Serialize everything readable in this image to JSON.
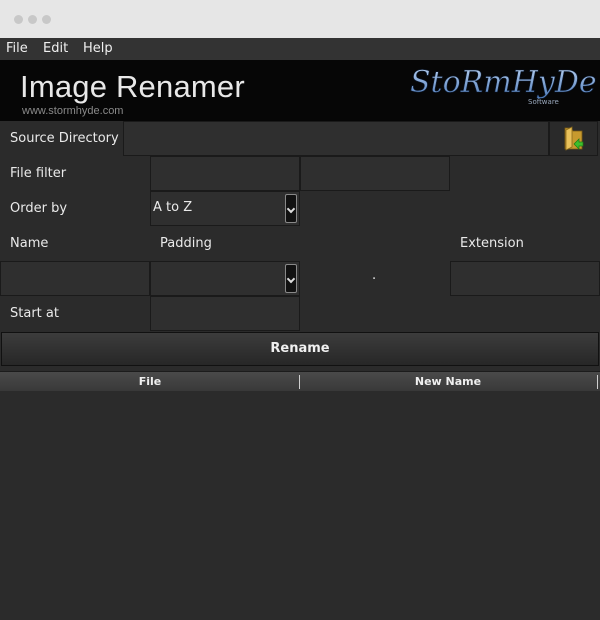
{
  "menu": {
    "items": [
      "File",
      "Edit",
      "Help"
    ]
  },
  "banner": {
    "title": "Image Renamer",
    "url": "www.stormhyde.com",
    "logo_text": "StoRmHyDe",
    "logo_sub": "Software"
  },
  "form": {
    "source_directory_label": "Source Directory",
    "source_directory_value": "",
    "file_filter_label": "File filter",
    "file_filter_value_1": "",
    "file_filter_value_2": "",
    "order_by_label": "Order by",
    "order_by_value": "A to Z",
    "name_label": "Name",
    "padding_label": "Padding",
    "extension_label": "Extension",
    "name_value": "",
    "padding_value": "",
    "separator": ".",
    "extension_value": "",
    "start_at_label": "Start at",
    "start_at_value": ""
  },
  "rename_button": "Rename",
  "table": {
    "columns": [
      "File",
      "New Name"
    ],
    "rows": []
  },
  "icons": {
    "folder": "folder-arrow-icon",
    "dropdown": "chevron-down-icon"
  },
  "colors": {
    "background": "#2b2b2b",
    "banner": "#060606",
    "logo": "#7aa4d6"
  }
}
